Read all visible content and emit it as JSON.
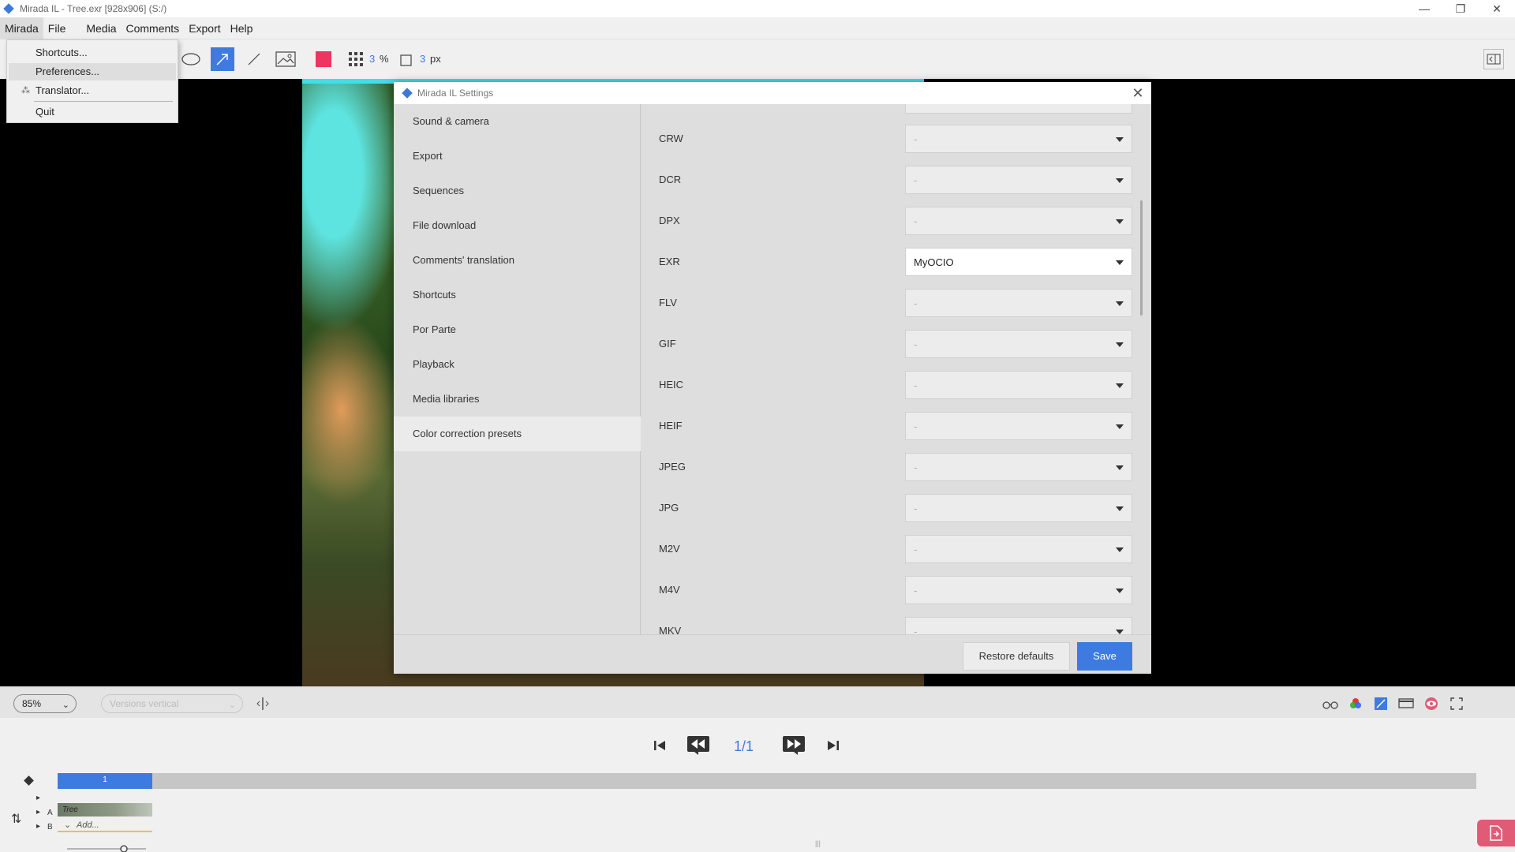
{
  "window": {
    "title": "Mirada IL - Tree.exr [928x906] (S:/)",
    "controls": {
      "minimize": "—",
      "maximize": "❐",
      "close": "✕"
    }
  },
  "menubar": {
    "items": [
      "Mirada",
      "File",
      "Media",
      "Comments",
      "Export",
      "Help"
    ]
  },
  "mirada_menu": {
    "items": [
      {
        "label": "Shortcuts...",
        "icon": ""
      },
      {
        "label": "Preferences...",
        "icon": ""
      },
      {
        "label": "Translator...",
        "icon": "translate-icon"
      },
      {
        "label": "Quit",
        "icon": ""
      }
    ]
  },
  "toolbar": {
    "grid_value": "3",
    "grid_unit": "%",
    "stroke_value": "3",
    "stroke_unit": "px",
    "color": "#ee3461"
  },
  "settings": {
    "title": "Mirada IL Settings",
    "sidebar": [
      "Sound & camera",
      "Export",
      "Sequences",
      "File download",
      "Comments' translation",
      "Shortcuts",
      "Por Parte",
      "Playback",
      "Media libraries",
      "Color correction presets"
    ],
    "selected_section": "Color correction presets",
    "rows": [
      {
        "format": "CRW",
        "value": "-"
      },
      {
        "format": "DCR",
        "value": "-"
      },
      {
        "format": "DPX",
        "value": "-"
      },
      {
        "format": "EXR",
        "value": "MyOCIO"
      },
      {
        "format": "FLV",
        "value": "-"
      },
      {
        "format": "GIF",
        "value": "-"
      },
      {
        "format": "HEIC",
        "value": "-"
      },
      {
        "format": "HEIF",
        "value": "-"
      },
      {
        "format": "JPEG",
        "value": "-"
      },
      {
        "format": "JPG",
        "value": "-"
      },
      {
        "format": "M2V",
        "value": "-"
      },
      {
        "format": "M4V",
        "value": "-"
      },
      {
        "format": "MKV",
        "value": "-"
      }
    ],
    "restore_label": "Restore defaults",
    "save_label": "Save"
  },
  "bottombar": {
    "zoom": "85%",
    "layout_placeholder": "Versions vertical"
  },
  "playback": {
    "frame_counter": "1/1",
    "timeline_segment": "1",
    "track_a": "A",
    "track_b": "B",
    "clip_name": "Tree",
    "add_label": "Add..."
  },
  "colors": {
    "accent": "#3e7be0",
    "export_button": "#e15b76"
  }
}
